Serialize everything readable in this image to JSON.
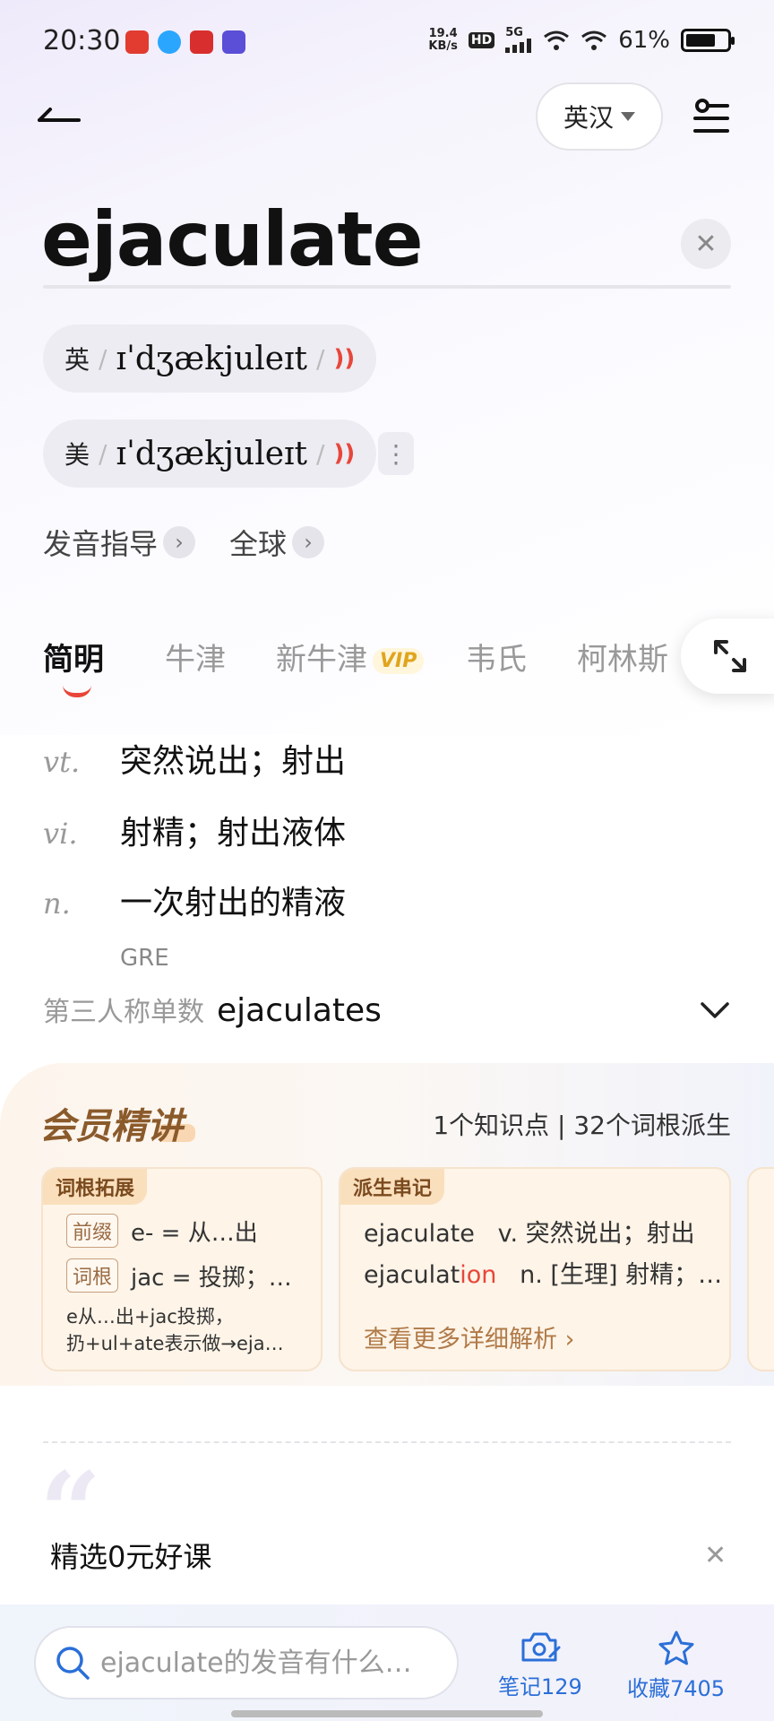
{
  "status_bar": {
    "time": "20:30",
    "net_speed_value": "19.4",
    "net_speed_unit": "KB/s",
    "hd": "HD",
    "signal": "5G",
    "battery": "61%"
  },
  "top_bar": {
    "lang_label": "英汉"
  },
  "word": "ejaculate",
  "pronunciations": [
    {
      "label": "英",
      "ipa": "ɪˈdʒækjuleɪt"
    },
    {
      "label": "美",
      "ipa": "ɪˈdʒækjuleɪt"
    }
  ],
  "links": {
    "guide": "发音指导",
    "global": "全球"
  },
  "tabs": [
    "简明",
    "牛津",
    "新牛津",
    "韦氏",
    "柯林斯"
  ],
  "vip_badge": "VIP",
  "definitions": [
    {
      "pos": "vt.",
      "meaning": "突然说出；射出"
    },
    {
      "pos": "vi.",
      "meaning": "射精；射出液体"
    },
    {
      "pos": "n.",
      "meaning": "一次射出的精液"
    }
  ],
  "exam_tag": "GRE",
  "inflection": {
    "label": "第三人称单数",
    "value": "ejaculates"
  },
  "member": {
    "title": "会员精讲",
    "stats": "1个知识点 | 32个词根派生",
    "card1": {
      "tag": "词根拓展",
      "prefix_chip": "前缀",
      "prefix_text": "e- = 从…出",
      "root_chip": "词根",
      "root_text": "jac = 投掷；…",
      "note_line1": "e从…出+jac投掷，",
      "note_line2": "扔+ul+ate表示做→eja…"
    },
    "card2": {
      "tag": "派生串记",
      "line1_word": "ejaculate",
      "line1_def": "v. 突然说出；射出",
      "line2_word_a": "ejaculat",
      "line2_word_b": "ion",
      "line2_def": "n. [生理] 射精；…",
      "more": "查看更多详细解析"
    }
  },
  "course": {
    "title": "精选0元好课"
  },
  "bottom": {
    "search_placeholder": "ejaculate的发音有什么…",
    "notes": "笔记129",
    "favorites": "收藏7405"
  }
}
